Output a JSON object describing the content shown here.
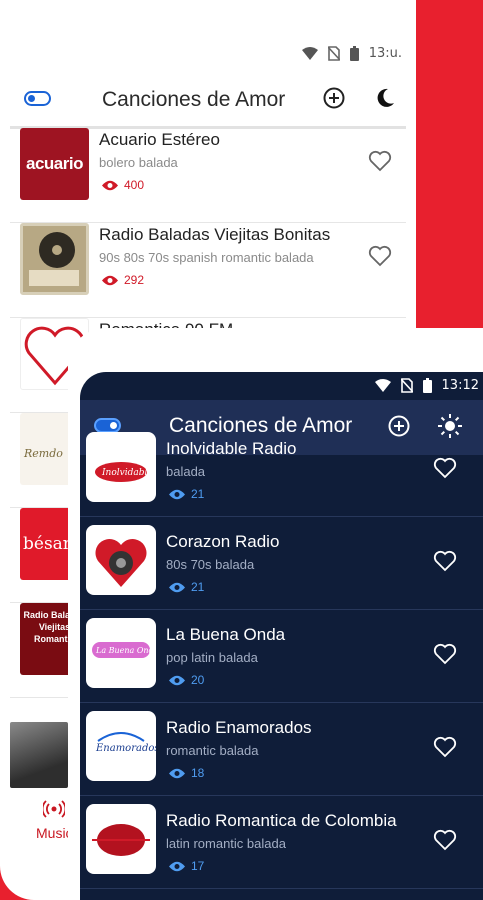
{
  "light": {
    "status_time": "13:u.",
    "title": "Canciones de Amor",
    "stations": [
      {
        "name": "Acuario Estéreo",
        "genre": "bolero balada",
        "views": "400",
        "thumb": "acuario",
        "thumb_text": "acuario"
      },
      {
        "name": "Radio Baladas Viejitas Bonitas",
        "genre": "90s 80s 70s spanish romantic balada",
        "views": "292",
        "thumb": "baladas",
        "thumb_text": ""
      },
      {
        "name": "Romantica 90 FM",
        "genre": "",
        "views": "",
        "thumb": "romantica",
        "thumb_text": ""
      },
      {
        "name": "",
        "genre": "",
        "views": "",
        "thumb": "remdo",
        "thumb_text": ""
      },
      {
        "name": "",
        "genre": "",
        "views": "",
        "thumb": "besame",
        "thumb_text": "bésam"
      },
      {
        "name": "",
        "genre": "",
        "views": "",
        "thumb": "radiobal",
        "thumb_text": "Radio Baladas Viejitas Romantic"
      }
    ],
    "bottom_tab_label": "Music",
    "accent": "#d01a28"
  },
  "dark": {
    "status_time": "13:12",
    "title": "Canciones de Amor",
    "stations": [
      {
        "name": "Inolvidable Radio",
        "genre": "balada",
        "views": "21"
      },
      {
        "name": "Corazon Radio",
        "genre": "80s 70s balada",
        "views": "21"
      },
      {
        "name": "La Buena Onda",
        "genre": "pop latin balada",
        "views": "20"
      },
      {
        "name": "Radio Enamorados",
        "genre": "romantic balada",
        "views": "18"
      },
      {
        "name": "Radio Romantica de Colombia",
        "genre": "latin romantic balada",
        "views": "17"
      }
    ],
    "accent": "#4f9cf0",
    "background": "#0f1d39"
  }
}
